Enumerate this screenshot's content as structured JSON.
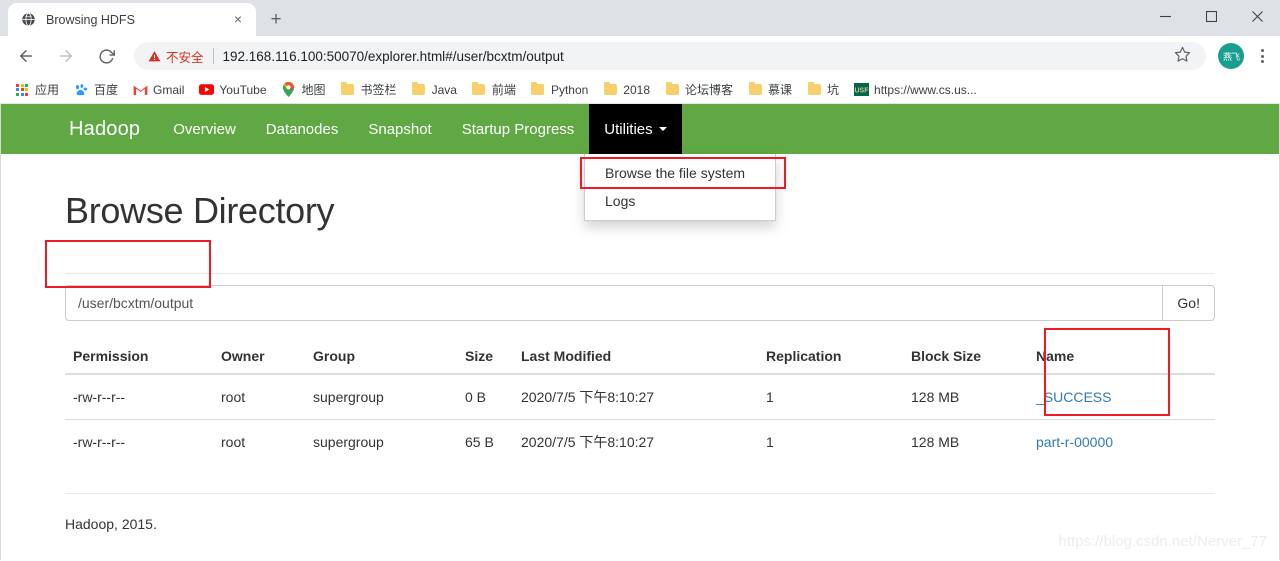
{
  "browser": {
    "tab": {
      "title": "Browsing HDFS",
      "favicon": "globe-icon",
      "close": "×"
    },
    "newtab_label": "+",
    "window_controls": {
      "minimize": "minimize-icon",
      "maximize": "maximize-icon",
      "close": "close-icon"
    },
    "nav": {
      "back": "back-arrow-icon",
      "forward": "forward-arrow-icon",
      "reload": "reload-icon"
    },
    "omnibox": {
      "security_label": "不安全",
      "security_icon": "warning-triangle-icon",
      "url": "192.168.116.100:50070/explorer.html#/user/bcxtm/output",
      "bookmark_icon": "star-icon"
    },
    "profile_initials": "燕飞",
    "menu_icon": "kebab-menu-icon",
    "bookmarks": [
      {
        "label": "应用",
        "icon": "apps-grid-icon"
      },
      {
        "label": "百度",
        "icon": "baidu-icon"
      },
      {
        "label": "Gmail",
        "icon": "gmail-icon"
      },
      {
        "label": "YouTube",
        "icon": "youtube-icon"
      },
      {
        "label": "地图",
        "icon": "maps-pin-icon"
      },
      {
        "label": "书签栏",
        "icon": "folder-icon"
      },
      {
        "label": "Java",
        "icon": "folder-icon"
      },
      {
        "label": "前端",
        "icon": "folder-icon"
      },
      {
        "label": "Python",
        "icon": "folder-icon"
      },
      {
        "label": "2018",
        "icon": "folder-icon"
      },
      {
        "label": "论坛博客",
        "icon": "folder-icon"
      },
      {
        "label": "慕课",
        "icon": "folder-icon"
      },
      {
        "label": "坑",
        "icon": "folder-icon"
      },
      {
        "label": "https://www.cs.us...",
        "icon": "usf-icon"
      }
    ]
  },
  "page": {
    "navbar": {
      "brand": "Hadoop",
      "items": [
        {
          "label": "Overview"
        },
        {
          "label": "Datanodes"
        },
        {
          "label": "Snapshot"
        },
        {
          "label": "Startup Progress"
        }
      ],
      "dropdown_toggle": "Utilities",
      "dropdown_items": [
        {
          "label": "Browse the file system"
        },
        {
          "label": "Logs"
        }
      ]
    },
    "title": "Browse Directory",
    "path_input": {
      "value": "/user/bcxtm/output",
      "placeholder": "Enter path"
    },
    "go_label": "Go!",
    "table": {
      "headers": [
        "Permission",
        "Owner",
        "Group",
        "Size",
        "Last Modified",
        "Replication",
        "Block Size",
        "Name"
      ],
      "rows": [
        {
          "permission": "-rw-r--r--",
          "owner": "root",
          "group": "supergroup",
          "size": "0 B",
          "last_modified": "2020/7/5 下午8:10:27",
          "replication": "1",
          "block_size": "128 MB",
          "name": "_SUCCESS"
        },
        {
          "permission": "-rw-r--r--",
          "owner": "root",
          "group": "supergroup",
          "size": "65 B",
          "last_modified": "2020/7/5 下午8:10:27",
          "replication": "1",
          "block_size": "128 MB",
          "name": "part-r-00000"
        }
      ]
    },
    "footer": "Hadoop, 2015.",
    "watermark": "https://blog.csdn.net/Nerver_77"
  },
  "colors": {
    "navbar_green": "#5fa843",
    "link_blue": "#337ab7",
    "annotation_red": "#ee1b24",
    "insecure_red": "#d93025"
  }
}
